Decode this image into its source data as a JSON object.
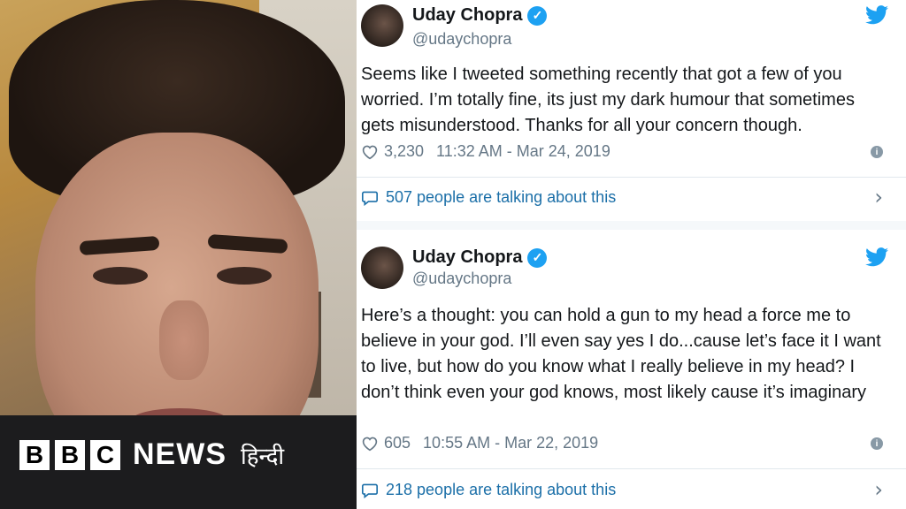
{
  "branding": {
    "b1": "B",
    "b2": "B",
    "b3": "C",
    "news": "NEWS",
    "language": "हिन्दी"
  },
  "tweets": [
    {
      "name": "Uday Chopra",
      "handle": "@udaychopra",
      "text": "Seems like I tweeted something recently that got a few of you worried. I’m totally fine, its just my dark humour that sometimes gets misunderstood. Thanks for all your concern though.",
      "likes": "3,230",
      "timestamp": "11:32 AM - Mar 24, 2019",
      "talking": "507 people are talking about this"
    },
    {
      "name": "Uday Chopra",
      "handle": "@udaychopra",
      "text": "Here’s a thought: you can hold a gun to my head a force me to believe in your god. I’ll even say yes I do...cause let’s face it I want to live, but how do you know what I really believe in my head? I don’t think even your god knows, most likely cause it’s imaginary",
      "likes": "605",
      "timestamp": "10:55 AM - Mar 22, 2019",
      "talking": "218 people are talking about this"
    }
  ],
  "icons": {
    "verified": "verified-badge-icon",
    "twitter": "twitter-bird-icon",
    "heart": "heart-icon",
    "info": "info-icon",
    "chat": "speech-bubble-icon",
    "chevron": "chevron-right-icon"
  },
  "colors": {
    "twitter_blue": "#1da1f2",
    "link": "#1b6fa8",
    "muted": "#657786"
  }
}
